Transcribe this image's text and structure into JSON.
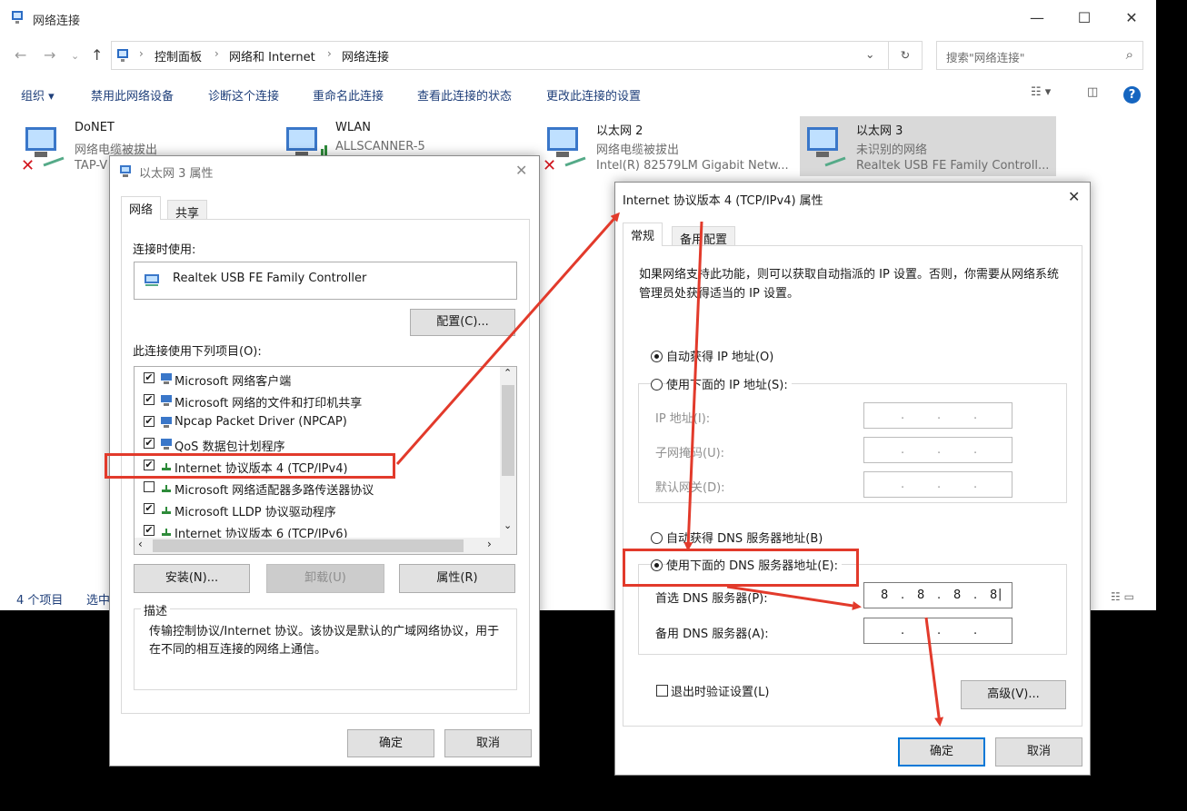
{
  "explorer": {
    "title": "网络连接",
    "breadcrumb": [
      "控制面板",
      "网络和 Internet",
      "网络连接"
    ],
    "search_placeholder": "搜索\"网络连接\"",
    "commands": [
      "组织 ▾",
      "禁用此网络设备",
      "诊断这个连接",
      "重命名此连接",
      "查看此连接的状态",
      "更改此连接的设置"
    ],
    "connections": [
      {
        "name": "DoNET",
        "line2": "网络电缆被拔出",
        "line3": "TAP-V"
      },
      {
        "name": "WLAN",
        "line2": "ALLSCANNER-5",
        "line3": ""
      },
      {
        "name": "以太网 2",
        "line2": "网络电缆被拔出",
        "line3": "Intel(R) 82579LM Gigabit Netw..."
      },
      {
        "name": "以太网 3",
        "line2": "未识别的网络",
        "line3": "Realtek USB FE Family Controll..."
      }
    ],
    "status_count": "4 个项目",
    "status_selected": "选中"
  },
  "props_dialog": {
    "title": "以太网 3 属性",
    "tabs": [
      "网络",
      "共享"
    ],
    "connect_using_label": "连接时使用:",
    "adapter": "Realtek USB FE Family Controller",
    "configure_button": "配置(C)...",
    "items_label": "此连接使用下列项目(O):",
    "items": [
      {
        "label": "Microsoft 网络客户端",
        "checked": "✔"
      },
      {
        "label": "Microsoft 网络的文件和打印机共享",
        "checked": "✔"
      },
      {
        "label": "Npcap Packet Driver (NPCAP)",
        "checked": "✔"
      },
      {
        "label": "QoS 数据包计划程序",
        "checked": "✔"
      },
      {
        "label": "Internet 协议版本 4 (TCP/IPv4)",
        "checked": "✔"
      },
      {
        "label": "Microsoft 网络适配器多路传送器协议",
        "checked": ""
      },
      {
        "label": "Microsoft LLDP 协议驱动程序",
        "checked": "✔"
      },
      {
        "label": "Internet 协议版本 6 (TCP/IPv6)",
        "checked": "✔"
      }
    ],
    "install_button": "安装(N)...",
    "uninstall_button": "卸载(U)",
    "properties_button": "属性(R)",
    "description_label": "描述",
    "description_text": "传输控制协议/Internet 协议。该协议是默认的广域网络协议，用于在不同的相互连接的网络上通信。",
    "ok_button": "确定",
    "cancel_button": "取消"
  },
  "ipv4_dialog": {
    "title": "Internet 协议版本 4 (TCP/IPv4) 属性",
    "tabs": [
      "常规",
      "备用配置"
    ],
    "intro": "如果网络支持此功能，则可以获取自动指派的 IP 设置。否则，你需要从网络系统管理员处获得适当的 IP 设置。",
    "auto_ip": "自动获得 IP 地址(O)",
    "manual_ip": "使用下面的 IP 地址(S):",
    "ip_address_label": "IP 地址(I):",
    "subnet_label": "子网掩码(U):",
    "gateway_label": "默认网关(D):",
    "auto_dns": "自动获得 DNS 服务器地址(B)",
    "manual_dns": "使用下面的 DNS 服务器地址(E):",
    "preferred_dns_label": "首选 DNS 服务器(P):",
    "preferred_dns": [
      "8",
      "8",
      "8",
      "8"
    ],
    "alternate_dns_label": "备用 DNS 服务器(A):",
    "validate_label": "退出时验证设置(L)",
    "advanced_button": "高级(V)...",
    "ok_button": "确定",
    "cancel_button": "取消",
    "dot": "."
  },
  "annotation_color": "#e23a2b",
  "icons": [
    "network-connections-icon",
    "search-icon",
    "refresh-icon",
    "help-icon",
    "network-adapter-icon",
    "close-icon"
  ]
}
